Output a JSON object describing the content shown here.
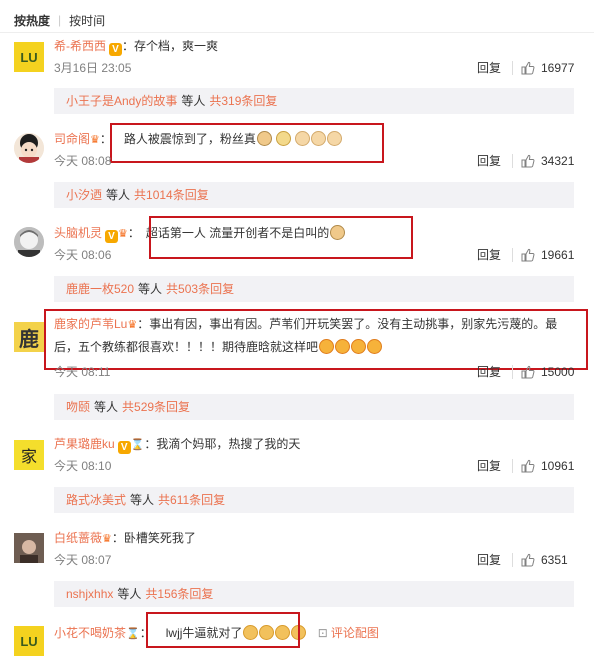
{
  "sort": {
    "hot": "按热度",
    "time": "按时间"
  },
  "ui": {
    "reply": "回复",
    "colon": "：",
    "dot": "·",
    "pic_comment": "评论配图"
  },
  "comments": [
    {
      "user": "希-希西西",
      "text": "存个档，爽一爽",
      "time": "3月16日 23:05",
      "likes": "16977",
      "sub": {
        "who": "小王子是Andy的故事",
        "mid": "等人",
        "count": "共319条回复"
      }
    },
    {
      "user": "司命阁",
      "text": "路人被震惊到了，粉丝真",
      "time": "今天 08:08",
      "likes": "34321",
      "sub": {
        "who": "小汐迺",
        "mid": "等人",
        "count": "共1014条回复"
      }
    },
    {
      "user": "头脑机灵",
      "text": "超话第一人 流量开创者不是白叫的",
      "time": "今天 08:06",
      "likes": "19661",
      "sub": {
        "who": "鹿鹿一枚520",
        "mid": "等人",
        "count": "共503条回复"
      }
    },
    {
      "user": "鹿家的芦苇Lu",
      "text": "事出有因，事出有因。芦苇们开玩笑罢了。没有主动挑事，别家先污蔑的。最后，五个教练都很喜欢！！！！期待鹿晗就这样吧",
      "time": "今天 08:11",
      "likes": "15000",
      "sub": {
        "who": "吻颐",
        "mid": "等人",
        "count": "共529条回复"
      }
    },
    {
      "user": "芦果璐鹿ku",
      "text": "我滴个妈耶，热搜了我的天",
      "time": "今天 08:10",
      "likes": "10961",
      "sub": {
        "who": "路式冰美式",
        "mid": "等人",
        "count": "共611条回复"
      }
    },
    {
      "user": "白纸蔷薇",
      "text": "卧槽笑死我了",
      "time": "今天 08:07",
      "likes": "6351",
      "sub": {
        "who": "nshjxhhx",
        "mid": "等人",
        "count": "共156条回复"
      }
    },
    {
      "user": "小花不喝奶茶",
      "text": "lwjj牛逼就对了",
      "time": "",
      "likes": ""
    }
  ],
  "avatars": {
    "a1": "LU",
    "a4": "鹿",
    "a5": "家"
  },
  "colors": {
    "link": "#eb7350",
    "highlight_box": "#c8161d",
    "subbar_bg": "#f2f2f5"
  }
}
